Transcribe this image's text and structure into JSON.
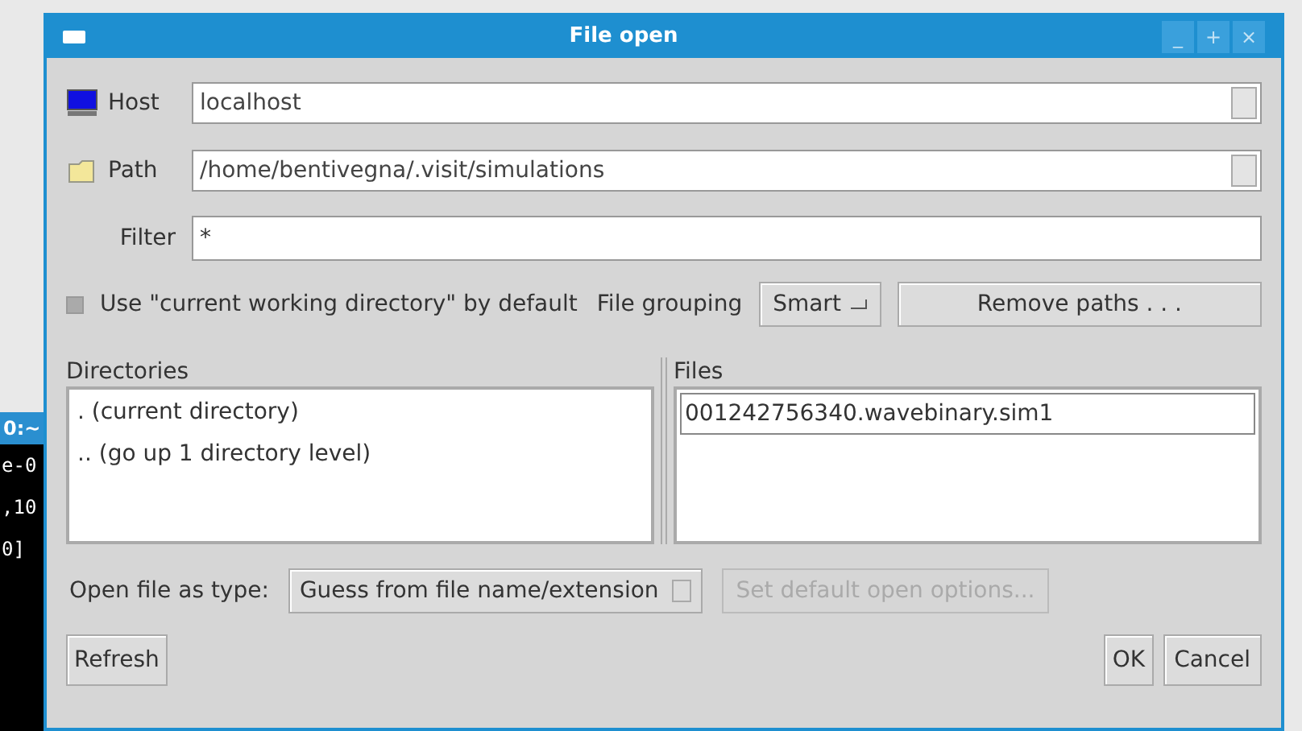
{
  "terminal": {
    "title": "0:~",
    "lines": [
      "e-0",
      ",10",
      "0]"
    ]
  },
  "window": {
    "title": "File open",
    "controls": [
      "_",
      "+",
      "×"
    ]
  },
  "host": {
    "label": "Host",
    "value": "localhost"
  },
  "path": {
    "label": "Path",
    "value": "/home/bentivegna/.visit/simulations"
  },
  "filter": {
    "label": "Filter",
    "value": "*"
  },
  "use_cwd": {
    "label": "Use \"current working directory\" by default",
    "checked": false
  },
  "file_grouping": {
    "label": "File grouping",
    "value": "Smart"
  },
  "remove_paths": {
    "label": "Remove paths . . ."
  },
  "directories": {
    "label": "Directories",
    "items": [
      {
        "label": ". (current directory)",
        "selected": false
      },
      {
        "label": ".. (go up 1 directory level)",
        "selected": false
      }
    ]
  },
  "files": {
    "label": "Files",
    "items": [
      {
        "label": "001242756340.wavebinary.sim1",
        "selected": true
      }
    ]
  },
  "open_as": {
    "label": "Open file as type:",
    "value": "Guess from file name/extension"
  },
  "default_options": {
    "label": "Set default open options...",
    "disabled": true
  },
  "buttons": {
    "refresh": "Refresh",
    "ok": "OK",
    "cancel": "Cancel"
  }
}
